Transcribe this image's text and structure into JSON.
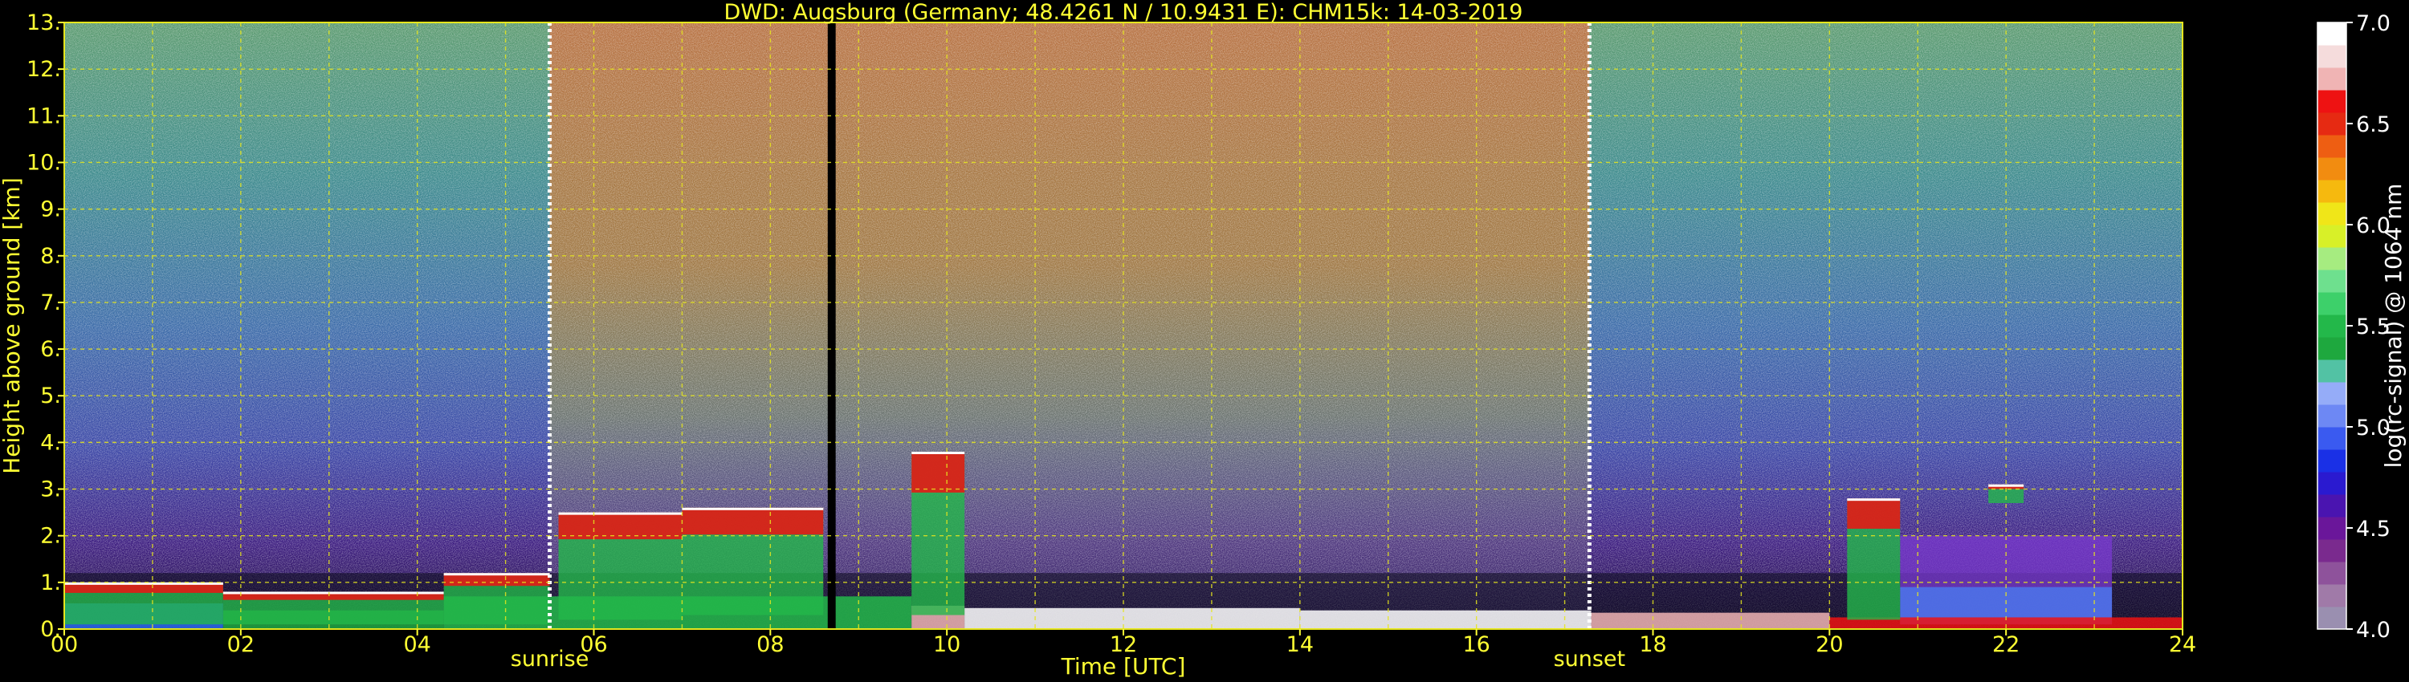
{
  "chart_data": {
    "type": "heatmap",
    "title": "DWD: Augsburg (Germany; 48.4261 N / 10.9431 E):    CHM15k: 14-03-2019",
    "xlabel": "Time [UTC]",
    "ylabel": "Height above ground [km]",
    "x_unit": "hour UTC",
    "y_unit": "km",
    "xlim": [
      0,
      24
    ],
    "ylim": [
      0,
      13
    ],
    "x_ticks": [
      0,
      2,
      4,
      6,
      8,
      10,
      12,
      14,
      16,
      18,
      20,
      22,
      24
    ],
    "x_tick_labels": [
      "00",
      "02",
      "04",
      "06",
      "08",
      "10",
      "12",
      "14",
      "16",
      "18",
      "20",
      "22",
      "24"
    ],
    "y_ticks": [
      0,
      1,
      2,
      3,
      4,
      5,
      6,
      7,
      8,
      9,
      10,
      11,
      12,
      13
    ],
    "y_tick_labels": [
      "0.",
      "1.",
      "2.",
      "3.",
      "4.",
      "5.",
      "6.",
      "7.",
      "8.",
      "9.",
      "10.",
      "11.",
      "12.",
      "13."
    ],
    "x_minor_step": 1,
    "y_minor_step": 1,
    "grid": true,
    "grid_color": "#e6e61e",
    "text_color": "#ffff33",
    "colorbar": {
      "label": "log(rc-signal) @ 1064 nm",
      "min": 4.0,
      "max": 7.0,
      "ticks": [
        4.0,
        4.5,
        5.0,
        5.5,
        6.0,
        6.5,
        7.0
      ],
      "tick_labels": [
        "4.0",
        "4.5",
        "5.0",
        "5.5",
        "6.0",
        "6.5",
        "7.0"
      ],
      "colors": [
        "#9a8fb0",
        "#a07aa8",
        "#8e529b",
        "#7a2a8e",
        "#6a169a",
        "#4a14b0",
        "#2a1ad0",
        "#1a30e6",
        "#3a5af0",
        "#6d88f4",
        "#95acf8",
        "#52c2a4",
        "#1ea83e",
        "#23b84a",
        "#3dd06a",
        "#6ee08e",
        "#a6ec80",
        "#d8f028",
        "#f0e618",
        "#f6b90e",
        "#f28c10",
        "#ee5e12",
        "#e62a12",
        "#ee1212",
        "#f0b4b4",
        "#f5dcdc",
        "#ffffff"
      ]
    },
    "day_markers": [
      {
        "label": "sunrise",
        "hour": 5.5
      },
      {
        "label": "sunset",
        "hour": 17.28
      }
    ],
    "data_gap": {
      "start_hour": 8.65,
      "end_hour": 8.74
    },
    "cloud_layers": [
      {
        "start_hour": 0.0,
        "end_hour": 1.8,
        "base_km": 0.1,
        "top_km": 1.0
      },
      {
        "start_hour": 1.8,
        "end_hour": 4.3,
        "base_km": 0.1,
        "top_km": 0.8
      },
      {
        "start_hour": 4.3,
        "end_hour": 5.5,
        "base_km": 0.1,
        "top_km": 1.2
      },
      {
        "start_hour": 5.6,
        "end_hour": 7.0,
        "base_km": 0.2,
        "top_km": 2.5
      },
      {
        "start_hour": 7.0,
        "end_hour": 8.6,
        "base_km": 0.3,
        "top_km": 2.6
      },
      {
        "start_hour": 9.6,
        "end_hour": 10.2,
        "base_km": 0.3,
        "top_km": 3.8
      },
      {
        "start_hour": 20.2,
        "end_hour": 20.8,
        "base_km": 0.2,
        "top_km": 2.8
      },
      {
        "start_hour": 21.8,
        "end_hour": 22.2,
        "base_km": 2.7,
        "top_km": 3.1
      }
    ],
    "aerosol_layer": {
      "start_hour": 20.8,
      "end_hour": 23.2,
      "base_km": 0.1,
      "top_km": 2.0
    }
  }
}
